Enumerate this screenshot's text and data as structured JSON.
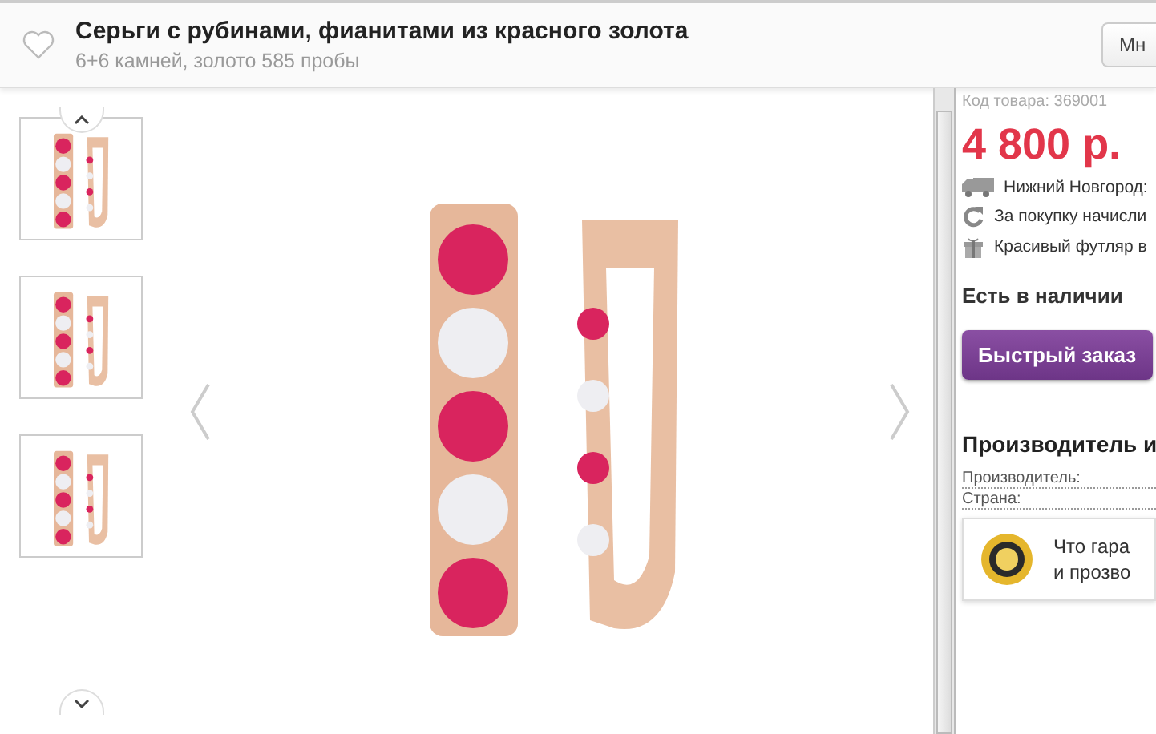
{
  "header": {
    "title": "Серьги с рубинами, фианитами из красного золота",
    "subtitle": "6+6 камней, золото 585 пробы",
    "button": "Мн"
  },
  "thumbnails": [
    {
      "selected": false
    },
    {
      "selected": false
    },
    {
      "selected": false
    }
  ],
  "product": {
    "code": "Код товара: 369001",
    "price": "4 800 р.",
    "features": [
      {
        "kind": "truck",
        "text": "Нижний Новгород:"
      },
      {
        "kind": "refresh",
        "text": "За покупку начисли"
      },
      {
        "kind": "gift",
        "text": "Красивый футляр в"
      }
    ],
    "availability": "Есть в наличии",
    "order_button": "Быстрый заказ",
    "section_title": "Производитель и",
    "specs": [
      {
        "label": "Производитель:"
      },
      {
        "label": "Страна:"
      }
    ],
    "guarantee": {
      "line_1": "Что гара",
      "line_2": "и прозво"
    }
  }
}
